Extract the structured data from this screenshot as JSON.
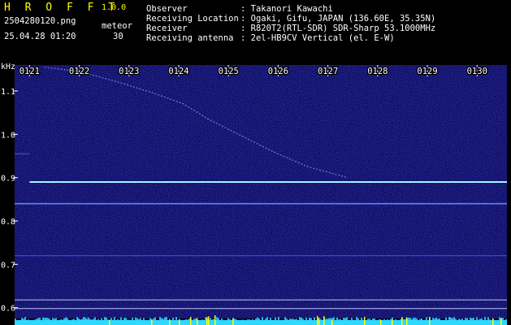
{
  "header": {
    "brand": "H R O F F T",
    "version": "1.0.0",
    "filename": "2504280120.png",
    "datetime": "25.04.28 01:20",
    "meteor_label": "meteor",
    "meteor_count": "30",
    "info": [
      {
        "label": "Observer",
        "value": ": Takanori Kawachi"
      },
      {
        "label": "Receiving Location",
        "value": ": Ogaki, Gifu, JAPAN (136.60E, 35.35N)"
      },
      {
        "label": "Receiver",
        "value": ": R820T2(RTL-SDR) SDR-Sharp 53.1000MHz"
      },
      {
        "label": "Receiving antenna",
        "value": ": 2el-HB9CV Vertical (el. E-W)"
      }
    ]
  },
  "colors": {
    "background": "#000000",
    "spectrogram_base": "#0a0a5a",
    "text": "#ffffff",
    "brand": "#ffff00",
    "carrier": "#9ff7ff",
    "signal_bar": "#2fd8ff",
    "signal_spike": "#ffff00"
  },
  "chart_data": {
    "type": "heatmap",
    "ylabel": "kHz",
    "x_ticks": [
      "0121",
      "0122",
      "0123",
      "0124",
      "0125",
      "0126",
      "0127",
      "0128",
      "0129",
      "0130"
    ],
    "y_ticks": [
      "1.1",
      "1.0",
      "0.9",
      "0.8",
      "0.7",
      "0.6"
    ],
    "xlim": [
      120.7,
      130.6
    ],
    "ylim": [
      0.575,
      1.16
    ],
    "persistent_lines": [
      {
        "name": "carrier",
        "freq_khz": 0.89,
        "t_start": 121.0,
        "t_end": 130.6
      },
      {
        "name": "interference",
        "freq_khz": 0.84,
        "t_start": 120.7,
        "t_end": 130.6
      },
      {
        "name": "faint",
        "freq_khz": 0.72,
        "t_start": 120.7,
        "t_end": 130.6
      },
      {
        "name": "faint",
        "freq_khz": 0.955,
        "t_start": 120.7,
        "t_end": 121.0
      },
      {
        "name": "reference",
        "freq_khz": 0.618,
        "t_start": 120.7,
        "t_end": 130.6
      },
      {
        "name": "reference",
        "freq_khz": 0.598,
        "t_start": 120.7,
        "t_end": 130.6
      }
    ],
    "drift_trace": [
      [
        121.3,
        1.155
      ],
      [
        122.0,
        1.145
      ],
      [
        122.8,
        1.12
      ],
      [
        123.5,
        1.095
      ],
      [
        124.1,
        1.07
      ],
      [
        124.6,
        1.035
      ],
      [
        125.2,
        1.0
      ],
      [
        125.9,
        0.96
      ],
      [
        126.6,
        0.925
      ],
      [
        127.4,
        0.9
      ]
    ]
  }
}
